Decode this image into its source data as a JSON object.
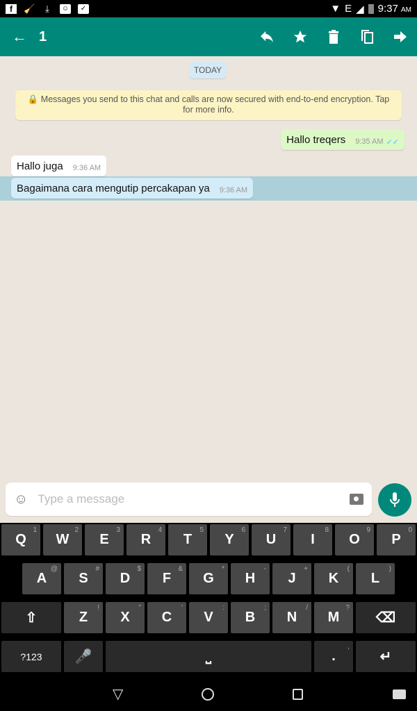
{
  "status_bar": {
    "time": "9:37",
    "ampm": "AM",
    "left_icons": [
      "facebook-icon",
      "cleaner-icon",
      "download-icon",
      "chat-icon",
      "bag-check-icon"
    ],
    "right_icons": [
      "wifi-icon",
      "network-e-icon",
      "signal-icon",
      "battery-icon"
    ],
    "network": "E"
  },
  "appbar": {
    "selected_count": "1",
    "actions": [
      "reply",
      "star",
      "delete",
      "copy",
      "forward"
    ],
    "color": "#00897b"
  },
  "chat": {
    "date_chip": "TODAY",
    "encryption_notice": "Messages you send to this chat and calls are now secured with end-to-end encryption. Tap for more info.",
    "messages": [
      {
        "text": "Hallo treqers",
        "time": "9:35 AM",
        "direction": "outgoing",
        "status": "read"
      },
      {
        "text": "Hallo juga",
        "time": "9:36 AM",
        "direction": "incoming"
      },
      {
        "text": "Bagaimana cara mengutip percakapan ya",
        "time": "9:36 AM",
        "direction": "incoming",
        "selected": true
      }
    ]
  },
  "input": {
    "placeholder": "Type a message"
  },
  "keyboard": {
    "row1": [
      {
        "k": "Q",
        "s": "1"
      },
      {
        "k": "W",
        "s": "2"
      },
      {
        "k": "E",
        "s": "3"
      },
      {
        "k": "R",
        "s": "4"
      },
      {
        "k": "T",
        "s": "5"
      },
      {
        "k": "Y",
        "s": "6"
      },
      {
        "k": "U",
        "s": "7"
      },
      {
        "k": "I",
        "s": "8"
      },
      {
        "k": "O",
        "s": "9"
      },
      {
        "k": "P",
        "s": "0"
      }
    ],
    "row2": [
      {
        "k": "A",
        "s": "@"
      },
      {
        "k": "S",
        "s": "#"
      },
      {
        "k": "D",
        "s": "$"
      },
      {
        "k": "F",
        "s": "&"
      },
      {
        "k": "G",
        "s": "*"
      },
      {
        "k": "H",
        "s": "-"
      },
      {
        "k": "J",
        "s": "+"
      },
      {
        "k": "K",
        "s": "("
      },
      {
        "k": "L",
        "s": ")"
      }
    ],
    "row3": [
      {
        "k": "Z",
        "s": "!"
      },
      {
        "k": "X",
        "s": "\""
      },
      {
        "k": "C",
        "s": "'"
      },
      {
        "k": "V",
        "s": ":"
      },
      {
        "k": "B",
        "s": ";"
      },
      {
        "k": "N",
        "s": "/"
      },
      {
        "k": "M",
        "s": "?"
      }
    ],
    "symbols_label": "?123",
    "period": ".",
    "period_alt": ","
  }
}
